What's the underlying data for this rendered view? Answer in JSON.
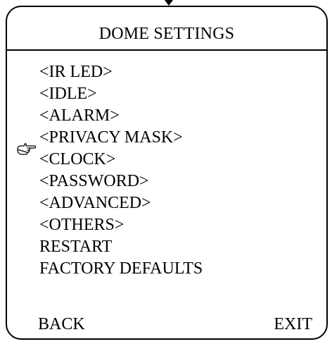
{
  "menu": {
    "title": "DOME SETTINGS",
    "items": [
      {
        "label": "<IR LED>"
      },
      {
        "label": "<IDLE>"
      },
      {
        "label": "<ALARM>"
      },
      {
        "label": "<PRIVACY MASK>"
      },
      {
        "label": "<CLOCK>"
      },
      {
        "label": "<PASSWORD>"
      },
      {
        "label": "<ADVANCED>"
      },
      {
        "label": "<OTHERS>"
      },
      {
        "label": "RESTART"
      },
      {
        "label": "FACTORY DEFAULTS"
      }
    ],
    "selected_index": 3,
    "pointer_icon": "pointing-hand-icon",
    "back_label": "BACK",
    "exit_label": "EXIT"
  }
}
